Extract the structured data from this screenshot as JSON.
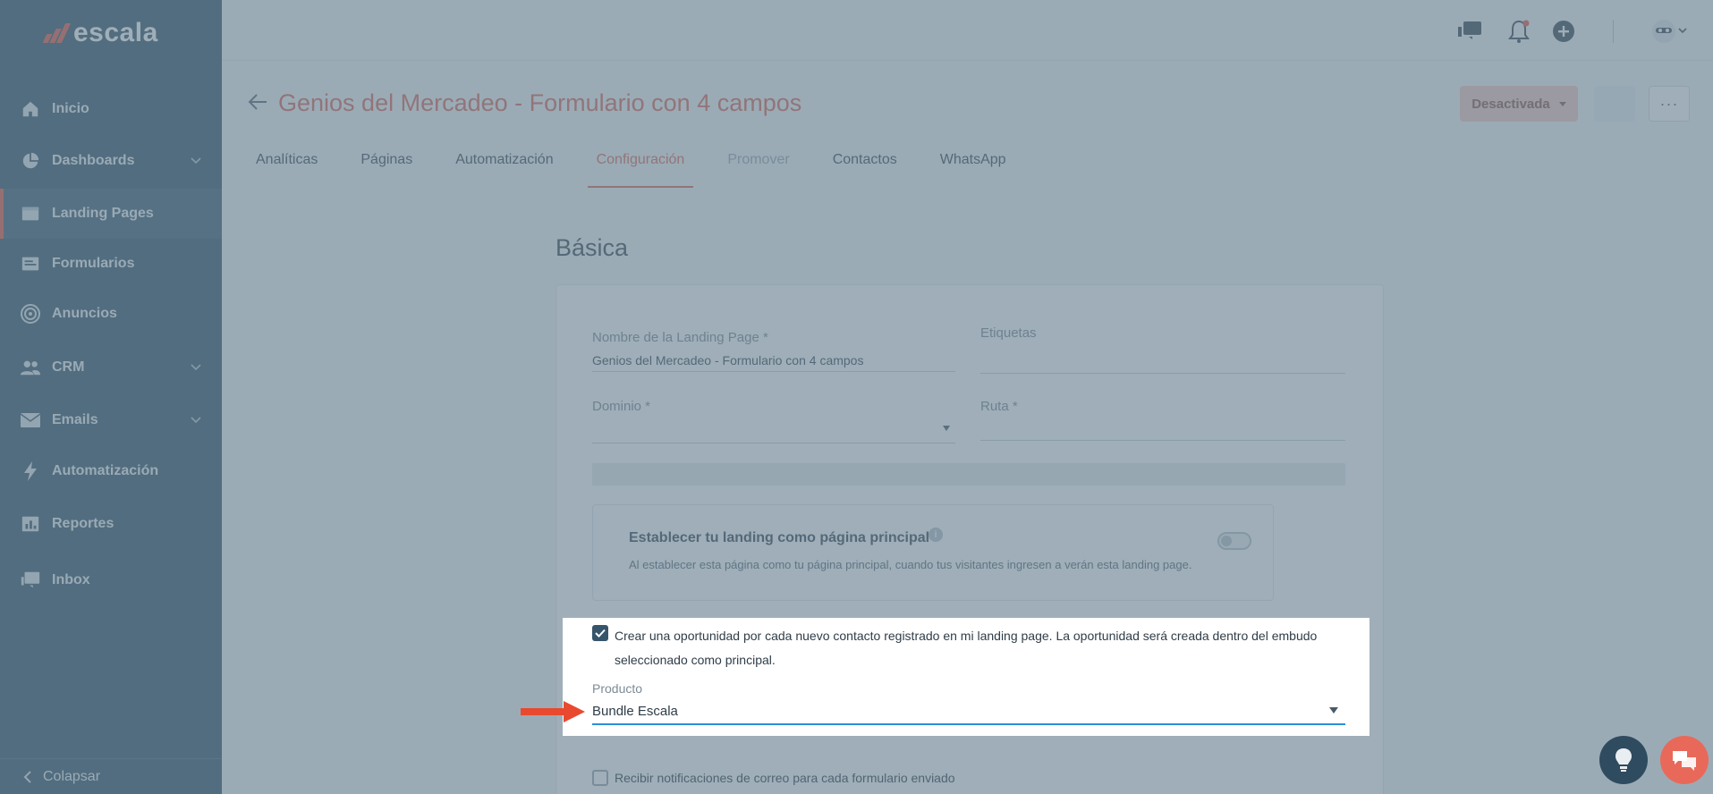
{
  "app": {
    "logo_text": "escala"
  },
  "sidebar": {
    "items": [
      {
        "label": "Inicio",
        "icon": "home-icon"
      },
      {
        "label": "Dashboards",
        "icon": "pie-chart-icon",
        "has_children": true
      },
      {
        "label": "Landing Pages",
        "icon": "landing-page-icon",
        "active": true
      },
      {
        "label": "Formularios",
        "icon": "form-icon"
      },
      {
        "label": "Anuncios",
        "icon": "target-icon"
      },
      {
        "label": "CRM",
        "icon": "users-icon",
        "has_children": true
      },
      {
        "label": "Emails",
        "icon": "mail-icon",
        "has_children": true
      },
      {
        "label": "Automatización",
        "icon": "bolt-icon"
      },
      {
        "label": "Reportes",
        "icon": "report-icon"
      },
      {
        "label": "Inbox",
        "icon": "inbox-icon"
      }
    ],
    "collapse_label": "Colapsar"
  },
  "header": {
    "title": "Genios del Mercadeo - Formulario con 4 campos",
    "status_label": "Desactivada",
    "more_label": "···"
  },
  "tabs": [
    {
      "label": "Analíticas",
      "state": "normal"
    },
    {
      "label": "Páginas",
      "state": "normal"
    },
    {
      "label": "Automatización",
      "state": "normal"
    },
    {
      "label": "Configuración",
      "state": "active"
    },
    {
      "label": "Promover",
      "state": "disabled"
    },
    {
      "label": "Contactos",
      "state": "normal"
    },
    {
      "label": "WhatsApp",
      "state": "normal"
    }
  ],
  "basic": {
    "section_title": "Básica",
    "name_label": "Nombre de la Landing Page *",
    "name_value": "Genios del Mercadeo - Formulario con 4 campos",
    "tags_label": "Etiquetas",
    "domain_label": "Dominio *",
    "route_label": "Ruta *",
    "home_title": "Establecer tu landing como página principal",
    "home_info": "i",
    "home_desc": "Al establecer esta página como tu página principal, cuando tus visitantes ingresen a verán esta landing page.",
    "home_toggle_on": false,
    "opportunity_text": "Crear una oportunidad por cada nuevo contacto registrado en mi landing page. La oportunidad será creada dentro del embudo seleccionado como principal.",
    "opportunity_checked": true,
    "product_label": "Producto",
    "product_value": "Bundle Escala",
    "notification_text": "Recibir notificaciones de correo para cada formulario enviado",
    "notification_checked": false
  },
  "colors": {
    "sidebar_bg": "#36556b",
    "accent": "#d96a5c",
    "brand_red": "#e85a47",
    "focus_blue": "#2a8fd6"
  }
}
